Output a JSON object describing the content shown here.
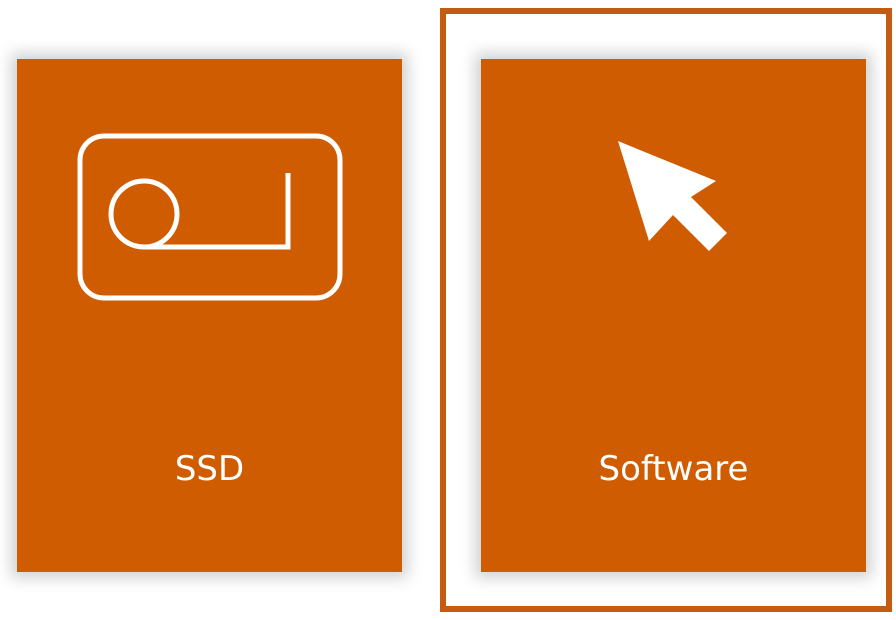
{
  "tiles": [
    {
      "label": "SSD",
      "icon": "ssd-drive-icon",
      "selected": false
    },
    {
      "label": "Software",
      "icon": "cursor-arrow-icon",
      "selected": true
    }
  ],
  "colors": {
    "tile_background": "#cf5c00",
    "selection_border": "#c55a11",
    "icon_and_text": "#ffffff"
  }
}
